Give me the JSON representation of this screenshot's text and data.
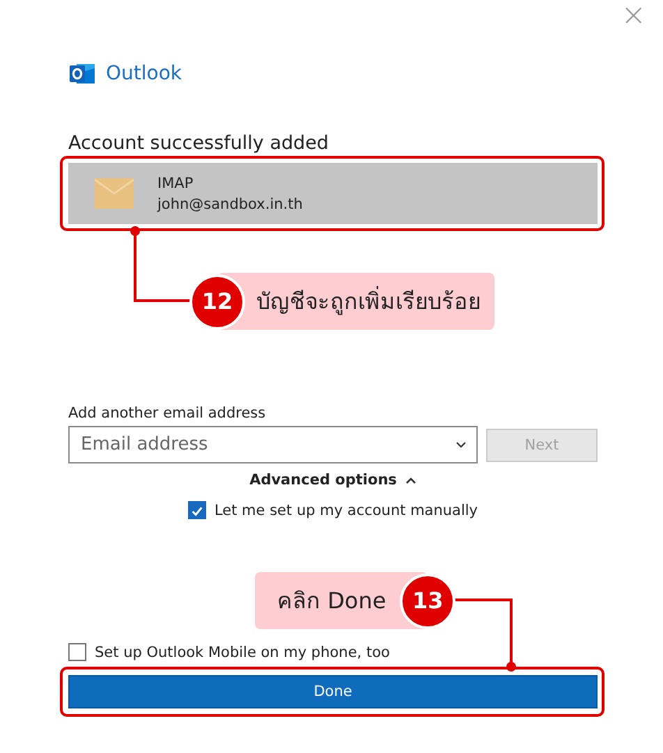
{
  "window": {
    "close": "×"
  },
  "app": {
    "name": "Outlook"
  },
  "heading": "Account successfully added",
  "accounts": [
    {
      "type": "IMAP",
      "email": "john@sandbox.in.th"
    }
  ],
  "add_another": {
    "label": "Add another email address",
    "placeholder": "Email address",
    "next_button": {
      "label": "Next",
      "disabled": true
    }
  },
  "advanced_options": {
    "label": "Advanced options",
    "expanded": true
  },
  "options": [
    {
      "label": "Let me set up my account manually",
      "checked": true
    }
  ],
  "mobile_option": {
    "label": "Set up Outlook Mobile on my phone, too",
    "checked": false
  },
  "done_button": "Done",
  "annotations": [
    {
      "number": "12",
      "text": "บัญชีจะถูกเพิ่มเรียบร้อย"
    },
    {
      "number": "13",
      "text": "คลิก Done"
    }
  ]
}
